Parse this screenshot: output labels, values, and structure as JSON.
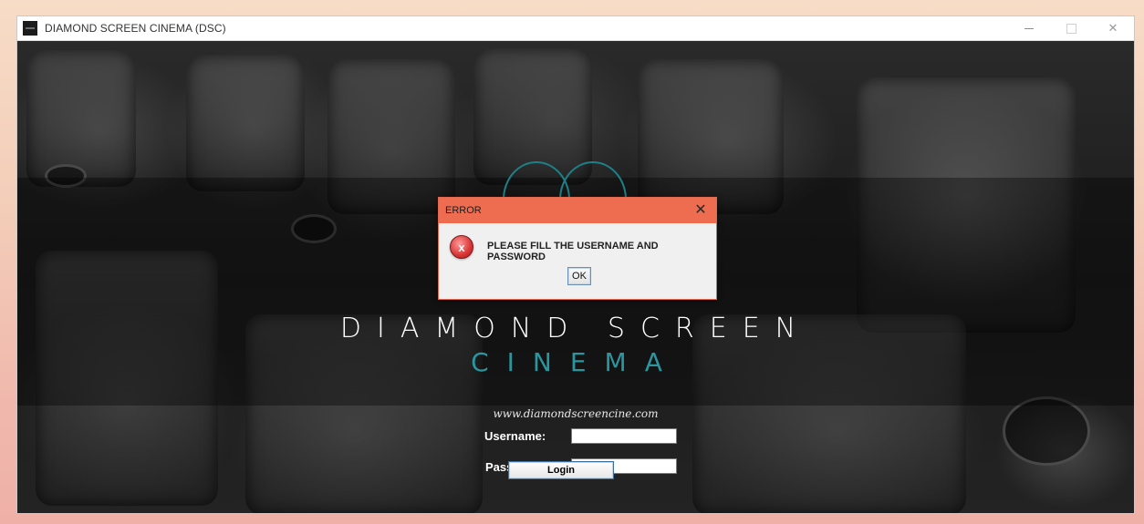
{
  "window": {
    "title": "DIAMOND SCREEN CINEMA (DSC)",
    "controls": {
      "minimize_icon": "minimize-icon",
      "maximize_icon": "maximize-icon",
      "close_icon": "close-icon",
      "close_glyph": "✕"
    }
  },
  "brand": {
    "title": "DIAMOND SCREEN",
    "subtitle": "CINEMA",
    "website": "www.diamondscreencine.com",
    "accent_color": "#2a96a0"
  },
  "login_form": {
    "username_label": "Username:",
    "username_value": "",
    "password_label": "Password:",
    "password_value": "",
    "login_button": "Login"
  },
  "error_dialog": {
    "title": "ERROR",
    "close_glyph": "✕",
    "icon_glyph": "x",
    "message": "PLEASE FILL THE USERNAME AND PASSWORD",
    "ok_button": "OK",
    "title_color": "#ee6d51"
  }
}
